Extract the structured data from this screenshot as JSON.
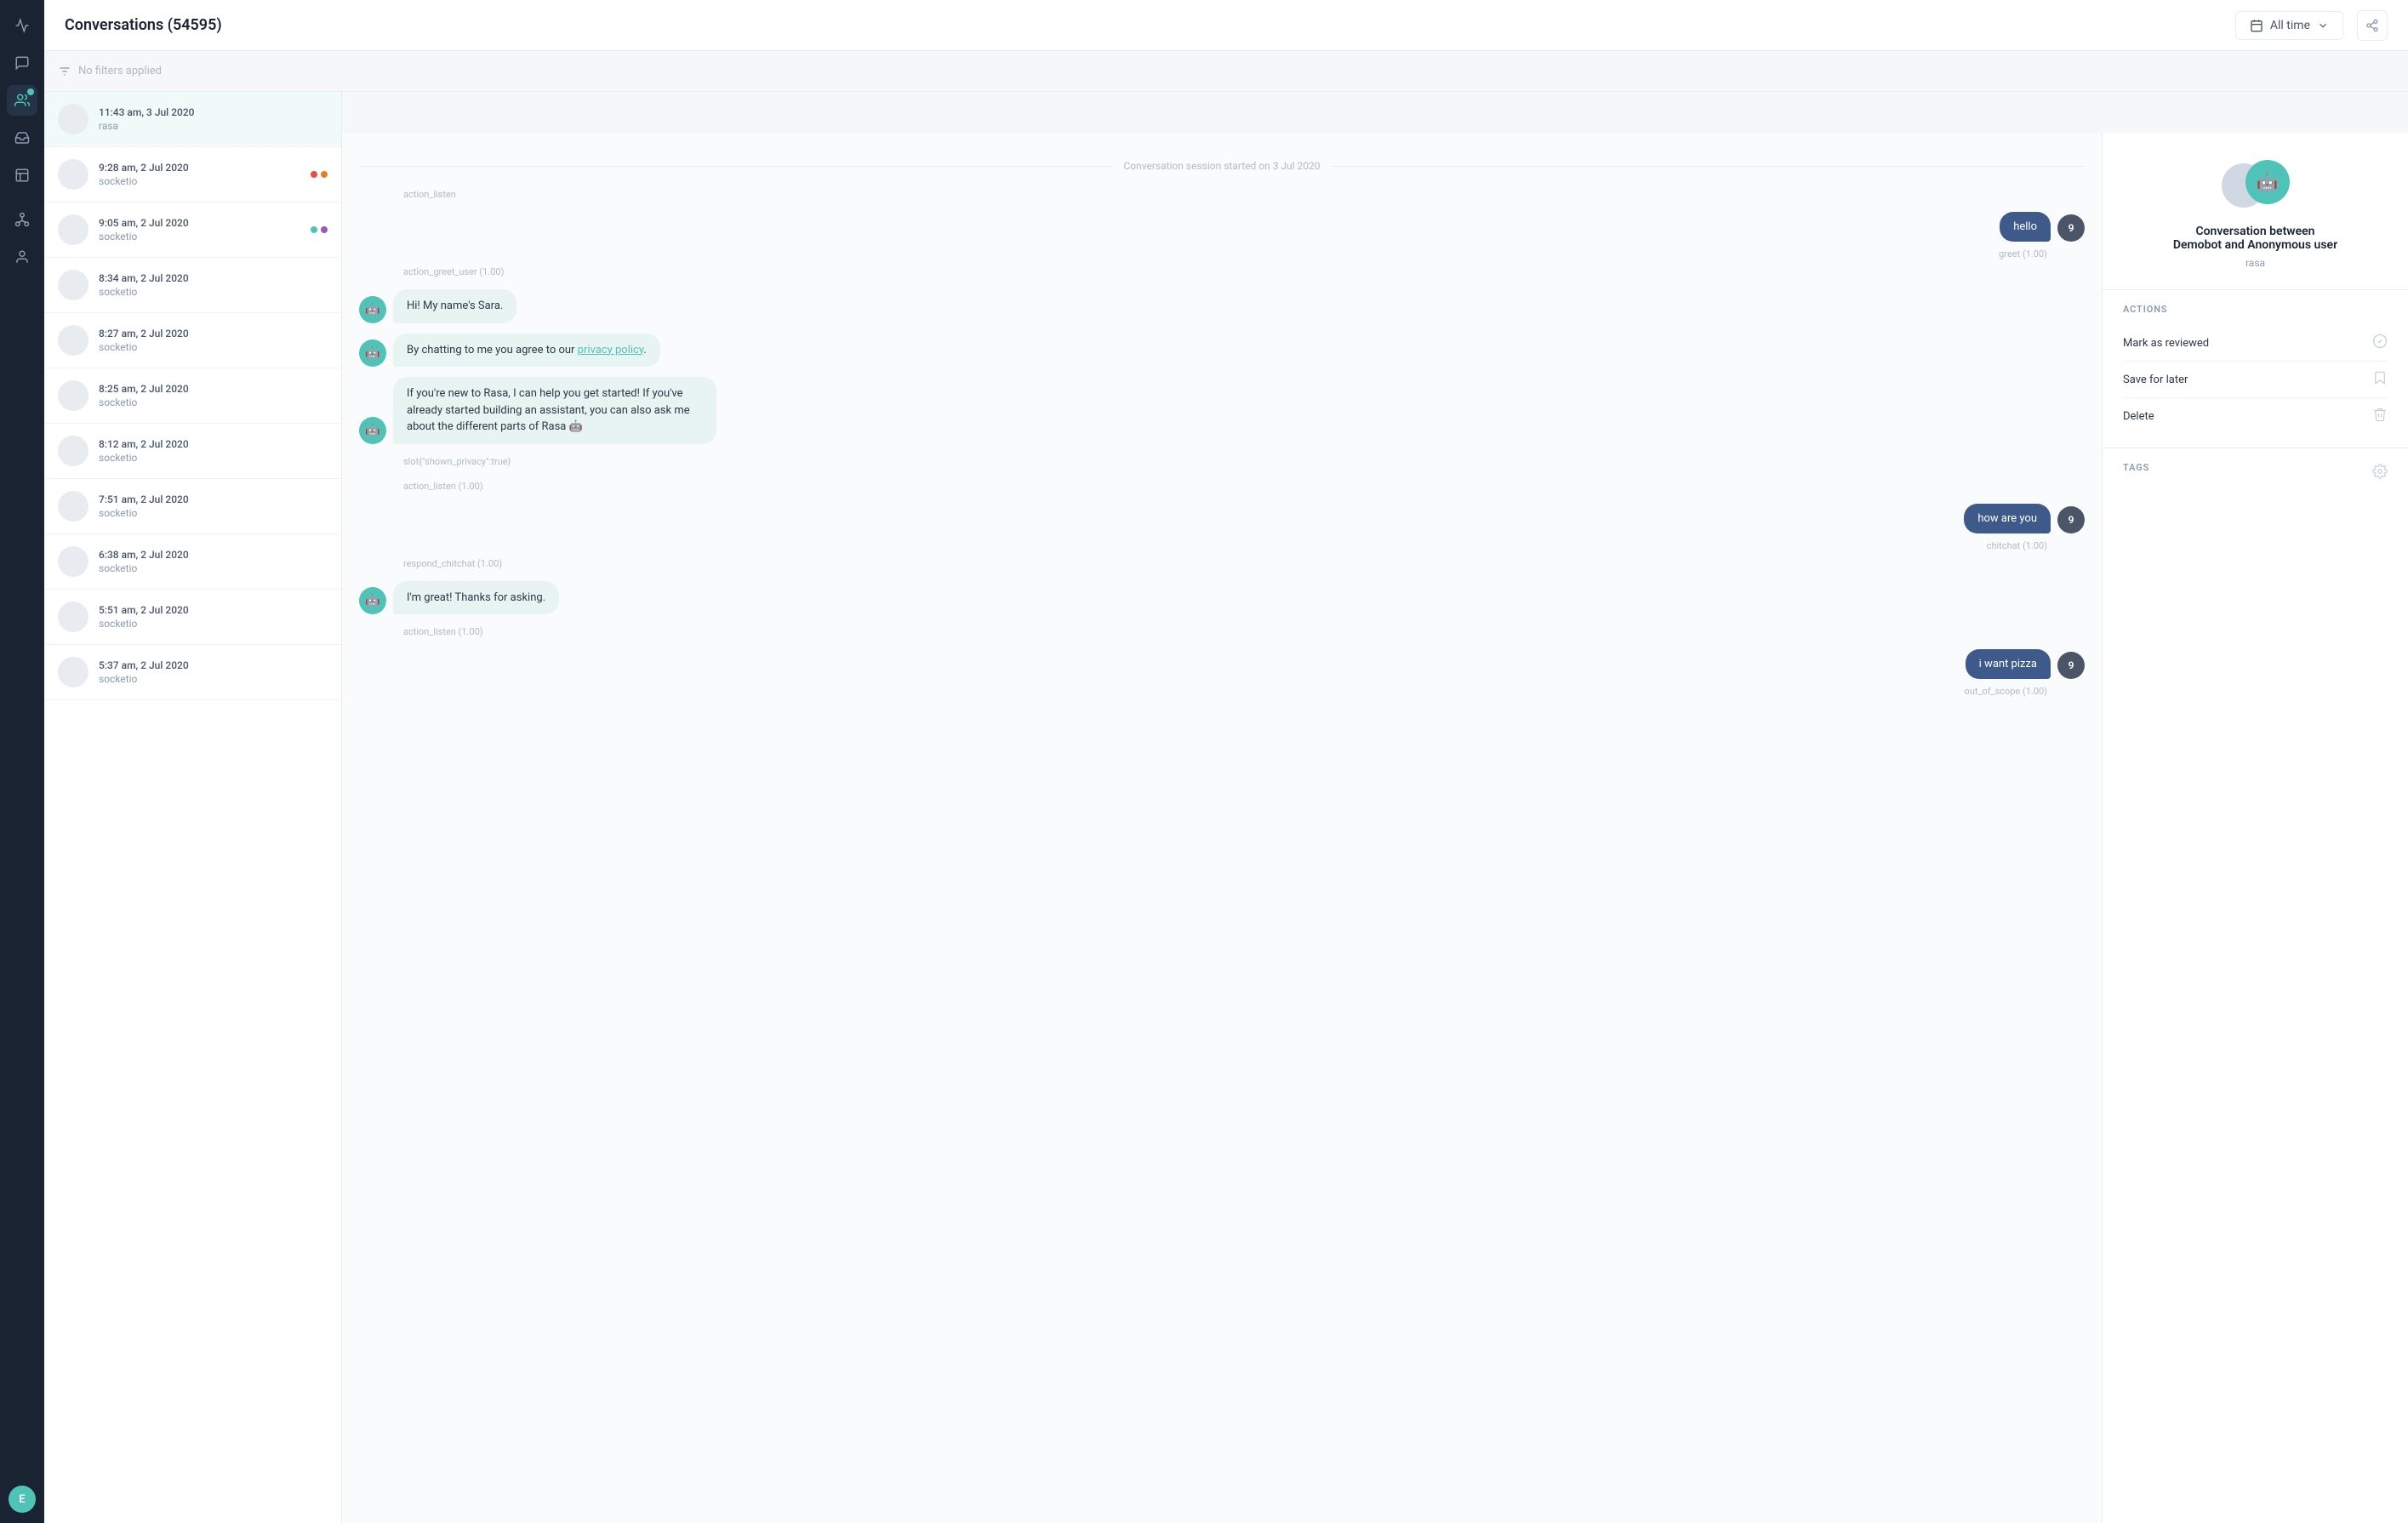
{
  "app": {
    "title": "Conversations (54595)"
  },
  "topbar": {
    "title": "Conversations (54595)",
    "time_filter": "All time",
    "share_label": "Share"
  },
  "filter": {
    "placeholder": "No filters applied"
  },
  "conversations": [
    {
      "time": "11:43 am, 3 Jul 2020",
      "name": "rasa",
      "dots": [],
      "active": true
    },
    {
      "time": "9:28 am, 2 Jul 2020",
      "name": "socketio",
      "dots": [
        "red",
        "orange"
      ],
      "active": false
    },
    {
      "time": "9:05 am, 2 Jul 2020",
      "name": "socketio",
      "dots": [
        "green",
        "purple"
      ],
      "active": false
    },
    {
      "time": "8:34 am, 2 Jul 2020",
      "name": "socketio",
      "dots": [],
      "active": false
    },
    {
      "time": "8:27 am, 2 Jul 2020",
      "name": "socketio",
      "dots": [],
      "active": false
    },
    {
      "time": "8:25 am, 2 Jul 2020",
      "name": "socketio",
      "dots": [],
      "active": false
    },
    {
      "time": "8:12 am, 2 Jul 2020",
      "name": "socketio",
      "dots": [],
      "active": false
    },
    {
      "time": "7:51 am, 2 Jul 2020",
      "name": "socketio",
      "dots": [],
      "active": false
    },
    {
      "time": "6:38 am, 2 Jul 2020",
      "name": "socketio",
      "dots": [],
      "active": false
    },
    {
      "time": "5:51 am, 2 Jul 2020",
      "name": "socketio",
      "dots": [],
      "active": false
    },
    {
      "time": "5:37 am, 2 Jul 2020",
      "name": "socketio",
      "dots": [],
      "active": false
    }
  ],
  "session_label": "Conversation session started on 3 Jul 2020",
  "messages": [
    {
      "type": "action",
      "text": "action_listen"
    },
    {
      "type": "user",
      "text": "hello",
      "intent": "greet (1.00)",
      "avatar": "9"
    },
    {
      "type": "action",
      "text": "action_greet_user (1.00)"
    },
    {
      "type": "bot",
      "text": "Hi! My name's Sara."
    },
    {
      "type": "bot",
      "text": "By chatting to me you agree to our privacy policy.",
      "has_link": true
    },
    {
      "type": "bot",
      "text": "If you're new to Rasa, I can help you get started! If you've already started building an assistant, you can also ask me about the different parts of Rasa 🤖"
    },
    {
      "type": "action_slot",
      "text": "slot{\"shown_privacy\":true}"
    },
    {
      "type": "action",
      "text": "action_listen (1.00)"
    },
    {
      "type": "user",
      "text": "how are you",
      "intent": "chitchat (1.00)",
      "avatar": "9"
    },
    {
      "type": "action",
      "text": "respond_chitchat (1.00)"
    },
    {
      "type": "bot",
      "text": "I'm great! Thanks for asking."
    },
    {
      "type": "action",
      "text": "action_listen (1.00)"
    },
    {
      "type": "user",
      "text": "i want pizza",
      "intent": "out_of_scope (1.00)",
      "avatar": "9"
    }
  ],
  "right_panel": {
    "conv_between": "Conversation between\nDemobot and Anonymous user",
    "rasa": "rasa",
    "actions_title": "ACTIONS",
    "actions": [
      {
        "label": "Mark as reviewed",
        "icon": "check-circle"
      },
      {
        "label": "Save for later",
        "icon": "bookmark"
      },
      {
        "label": "Delete",
        "icon": "trash"
      }
    ],
    "tags_title": "TAGS"
  }
}
